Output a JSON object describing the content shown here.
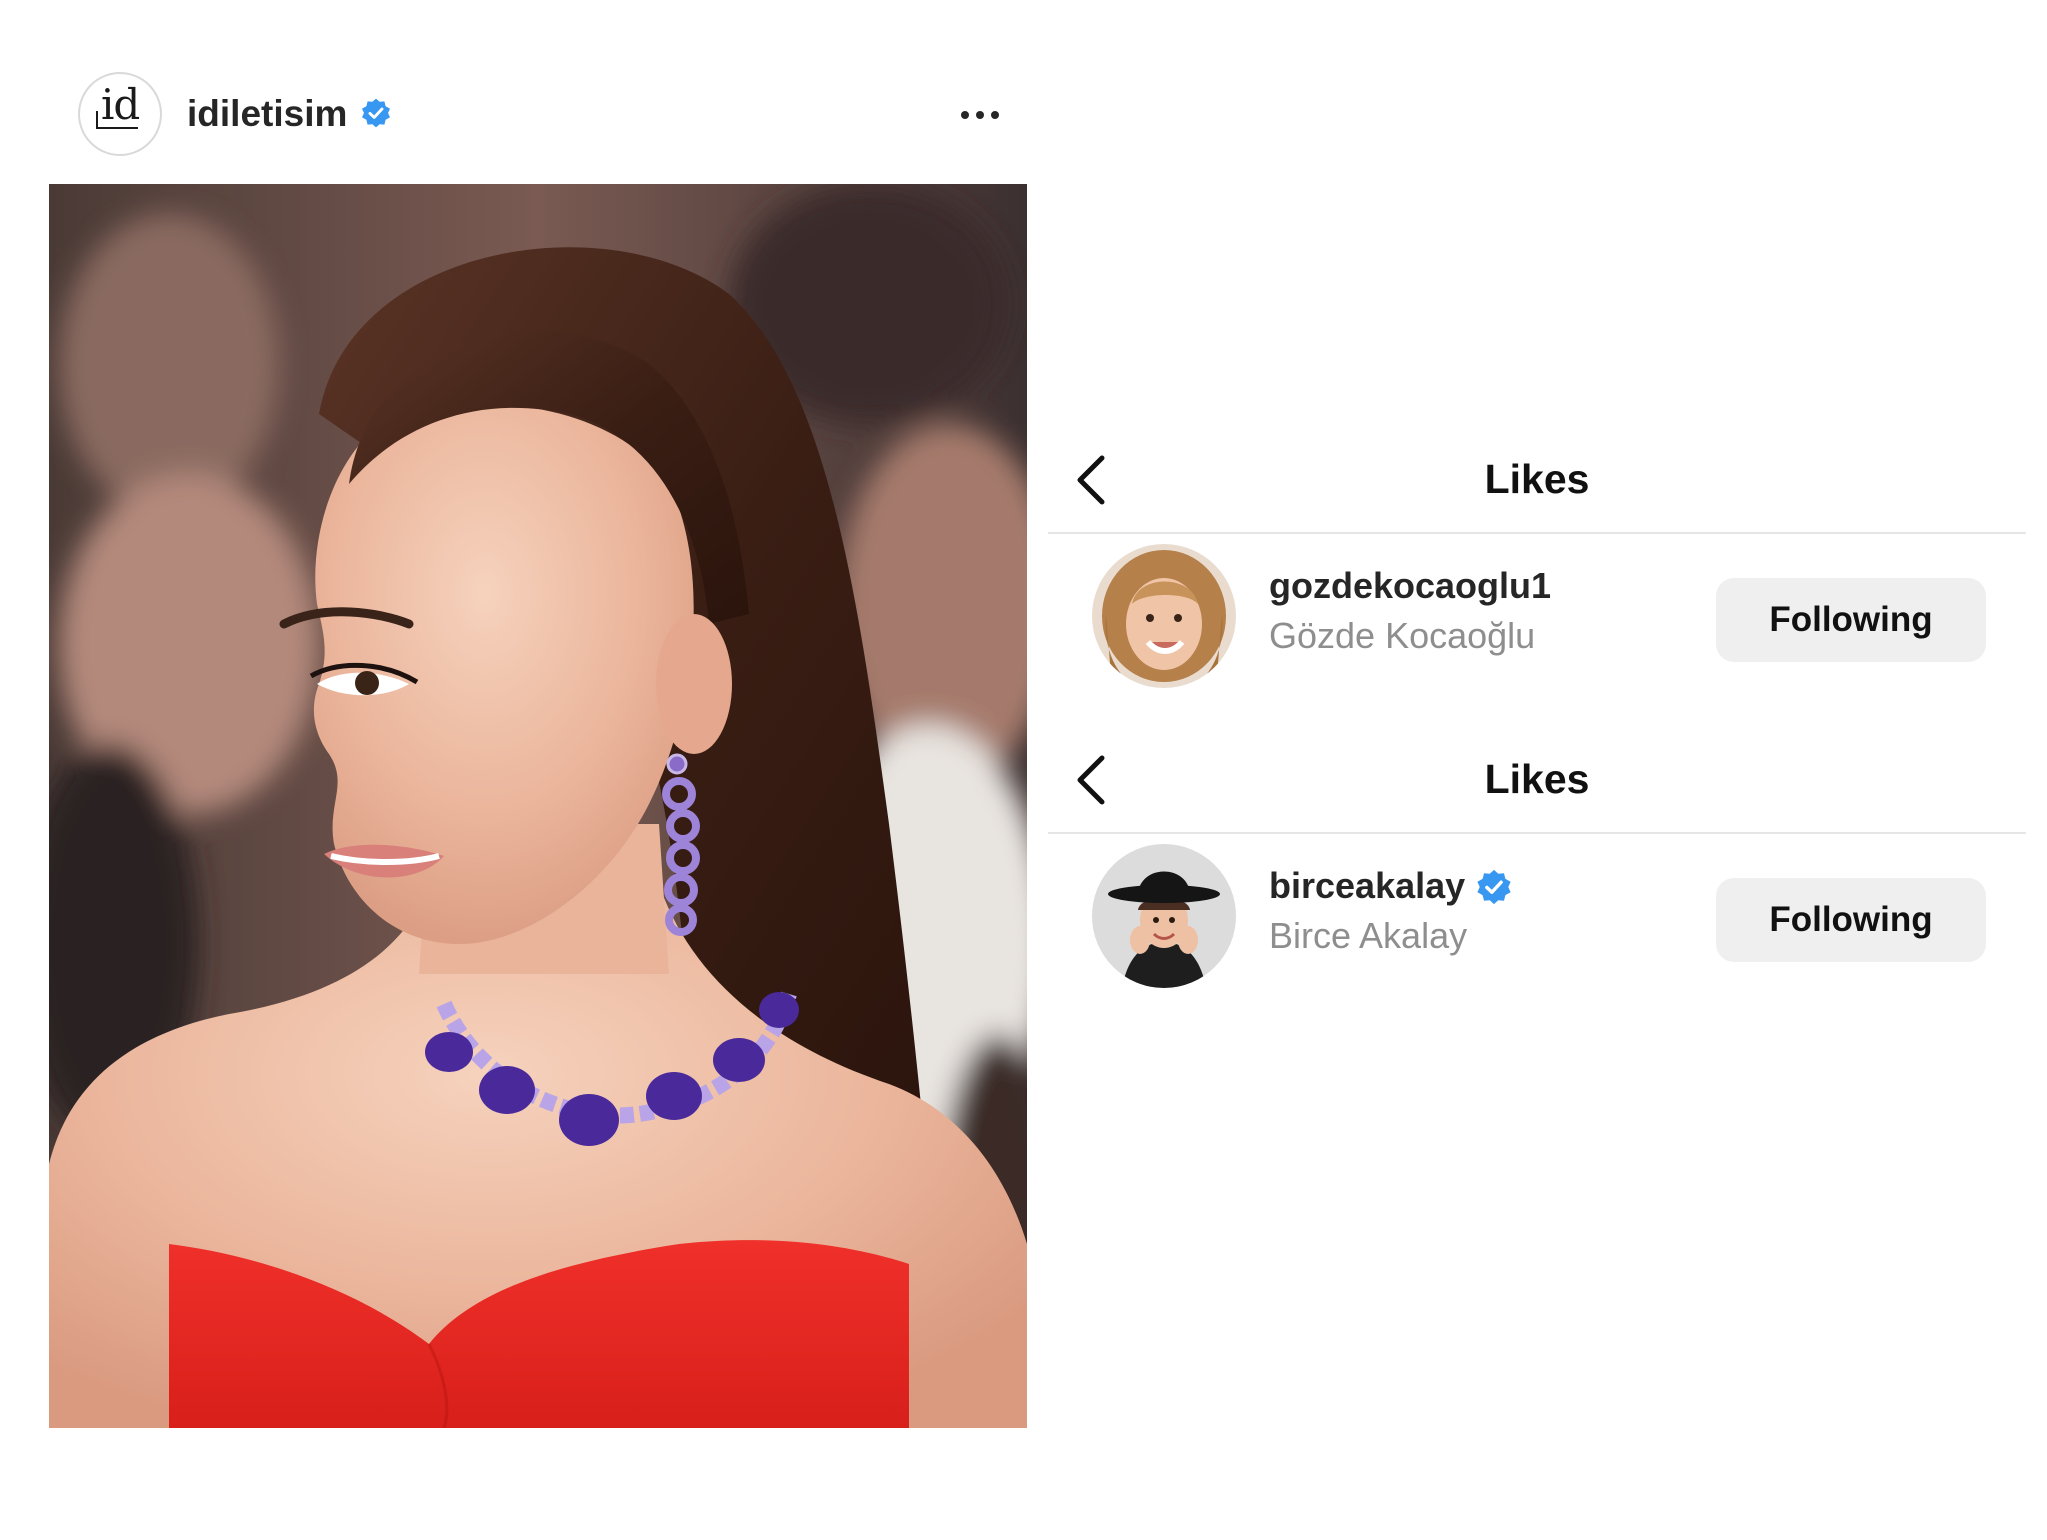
{
  "post": {
    "username": "idiletisim",
    "avatar_logo_text": "id",
    "avatar_icon": "id-logo-avatar",
    "verified_icon": "verified-badge-icon",
    "more_icon": "more-horizontal-icon",
    "image_description_icon": "post-photo"
  },
  "likes_panels": [
    {
      "title": "Likes",
      "back_icon": "chevron-left-icon",
      "user": {
        "handle": "gozdekocaoglu1",
        "full_name": "Gözde Kocaoğlu",
        "verified": false,
        "button_label": "Following"
      }
    },
    {
      "title": "Likes",
      "back_icon": "chevron-left-icon",
      "user": {
        "handle": "birceakalay",
        "full_name": "Birce Akalay",
        "verified": true,
        "button_label": "Following"
      }
    }
  ],
  "colors": {
    "verified_blue": "#3897f0",
    "button_bg": "#efefef",
    "secondary_text": "#8e8e8e",
    "divider": "#e6e6e6"
  }
}
